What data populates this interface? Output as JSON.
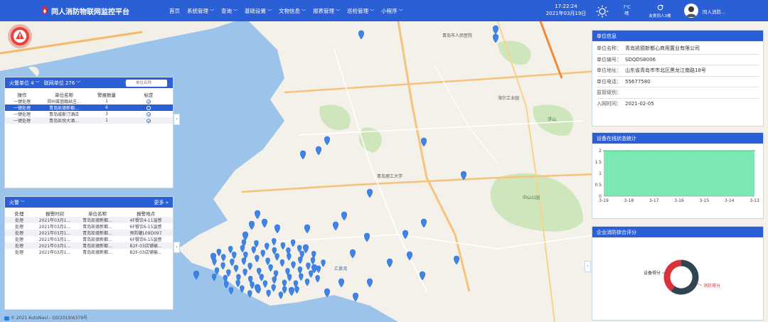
{
  "header": {
    "title": "同人消防物联网监控平台",
    "nav": [
      {
        "label": "首页",
        "has_menu": false
      },
      {
        "label": "系统管理",
        "has_menu": true
      },
      {
        "label": "查询",
        "has_menu": true
      },
      {
        "label": "基础设置",
        "has_menu": true
      },
      {
        "label": "文物信息",
        "has_menu": true
      },
      {
        "label": "报表管理",
        "has_menu": true
      },
      {
        "label": "巡检管理",
        "has_menu": true
      },
      {
        "label": "小程序",
        "has_menu": true
      }
    ],
    "time": "17:22:24",
    "date": "2021年03月19日",
    "weather_temp": "7℃",
    "weather_desc": "晴",
    "friendly_link": "友爱同人3楼",
    "user": "同人消防..."
  },
  "fire_units_panel": {
    "tab_fire": "火警单位 4",
    "tab_network": "联网单位 276",
    "search_placeholder": "单位名称",
    "columns": [
      "操作",
      "单位名称",
      "警报数量",
      "标定"
    ],
    "rows": [
      {
        "op": "一键处理",
        "name": "郑州莱茵翰丝庄...",
        "count": "1"
      },
      {
        "op": "一键处理",
        "name": "青岛凯德新都...",
        "count": "6"
      },
      {
        "op": "一键处理",
        "name": "青岛威斯汀酒店",
        "count": "3"
      },
      {
        "op": "一键处理",
        "name": "青岛凯悦大酒...",
        "count": "1"
      }
    ],
    "selected_row": 1
  },
  "alarm_panel": {
    "title": "火警",
    "more_label": "更多",
    "columns": [
      "处理",
      "报警时间",
      "单位名称",
      "报警地点"
    ],
    "rows": [
      {
        "op": "处理",
        "time": "2021年03月1...",
        "name": "青岛凯德新都...",
        "place": "4F餐饮4-11温感"
      },
      {
        "op": "处理",
        "time": "2021年03月1...",
        "name": "青岛凯德新都...",
        "place": "6F餐饮6-15温感"
      },
      {
        "op": "处理",
        "time": "2021年03月1...",
        "name": "青岛凯德新都...",
        "place": "预防罐L09D097"
      },
      {
        "op": "处理",
        "time": "2021年03月1...",
        "name": "青岛凯德新都...",
        "place": "6F餐饮6-15温感"
      },
      {
        "op": "处理",
        "time": "2021年03月1...",
        "name": "青岛凯德新都...",
        "place": "B2F-03店铺输..."
      },
      {
        "op": "处理",
        "time": "2021年03月1...",
        "name": "青岛凯德新都...",
        "place": "B2F-03店铺输..."
      }
    ]
  },
  "unit_info": {
    "title": "单位信息",
    "rows": [
      {
        "key": "单位名称：",
        "value": "青岛凯德新都心商用置业有限公司"
      },
      {
        "key": "单位编号：",
        "value": "SDQDS8006"
      },
      {
        "key": "单位地址：",
        "value": "山东省青岛市市北区黑龙江南路18号"
      },
      {
        "key": "单位电话：",
        "value": "55677580"
      },
      {
        "key": "监管级别：",
        "value": ""
      },
      {
        "key": "入网时间：",
        "value": "2021-02-05"
      }
    ]
  },
  "device_chart_panel": {
    "title": "设备在线状态统计"
  },
  "score_panel": {
    "title": "企业消防综合评分",
    "label_device": "设备得分",
    "label_fire": "消防得分"
  },
  "chart_data": [
    {
      "type": "area",
      "x": [
        "3-19",
        "3-18",
        "3-17",
        "3-16",
        "3-15",
        "3-14",
        "3-13"
      ],
      "values": [
        2,
        2,
        2,
        2,
        2,
        2,
        2
      ],
      "ylim": [
        0,
        2
      ],
      "yticks": [
        "0",
        "0.5",
        "1",
        "1.5",
        "2"
      ],
      "color": "#7de8b4",
      "line_color": "#3bbf7f"
    },
    {
      "type": "pie",
      "labels": [
        "设备得分",
        "消防得分"
      ],
      "values": [
        60,
        40
      ],
      "colors": [
        "#2f4552",
        "#d9333a"
      ]
    }
  ],
  "map": {
    "map_label_1": "青岛市人民医院",
    "map_label_2": "海尔工业园",
    "map_label_3": "青岛理工大学",
    "map_label_4": "中山公园",
    "map_label_5": "汇泉湾",
    "map_label_6": "浮山"
  },
  "footer": "© 2021 AutoNavi - GS(2019)6379号"
}
